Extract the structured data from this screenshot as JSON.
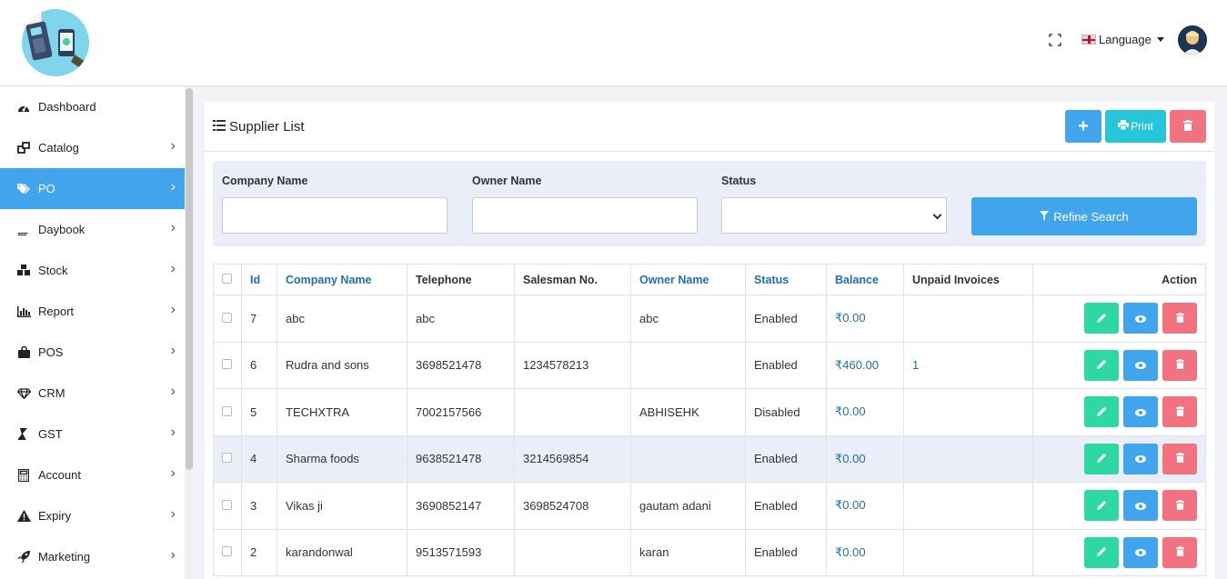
{
  "header": {
    "language_label": "Language"
  },
  "sidebar": {
    "items": [
      {
        "label": "Dashboard",
        "icon": "dashboard-icon",
        "active": false,
        "has_children": false
      },
      {
        "label": "Catalog",
        "icon": "catalog-icon",
        "active": false,
        "has_children": true
      },
      {
        "label": "PO",
        "icon": "tags-icon",
        "active": true,
        "has_children": true
      },
      {
        "label": "Daybook",
        "icon": "book-icon",
        "active": false,
        "has_children": true
      },
      {
        "label": "Stock",
        "icon": "cubes-icon",
        "active": false,
        "has_children": true
      },
      {
        "label": "Report",
        "icon": "bar-chart-icon",
        "active": false,
        "has_children": true
      },
      {
        "label": "POS",
        "icon": "shopping-bag-icon",
        "active": false,
        "has_children": true
      },
      {
        "label": "CRM",
        "icon": "diamond-icon",
        "active": false,
        "has_children": true
      },
      {
        "label": "GST",
        "icon": "gst-icon",
        "active": false,
        "has_children": true
      },
      {
        "label": "Account",
        "icon": "calculator-icon",
        "active": false,
        "has_children": true
      },
      {
        "label": "Expiry",
        "icon": "warning-icon",
        "active": false,
        "has_children": true
      },
      {
        "label": "Marketing",
        "icon": "rocket-icon",
        "active": false,
        "has_children": true
      }
    ]
  },
  "card": {
    "title": "Supplier List",
    "print_label": "Print"
  },
  "filter": {
    "company_label": "Company Name",
    "company_value": "",
    "owner_label": "Owner Name",
    "owner_value": "",
    "status_label": "Status",
    "status_value": "",
    "refine_label": "Refine Search"
  },
  "table": {
    "headers": [
      "Id",
      "Company Name",
      "Telephone",
      "Salesman No.",
      "Owner Name",
      "Status",
      "Balance",
      "Unpaid Invoices",
      "Action"
    ],
    "rows": [
      {
        "id": "7",
        "company": "abc",
        "telephone": "abc",
        "salesman": "",
        "owner": "abc",
        "status": "Enabled",
        "balance": "₹0.00",
        "unpaid": "",
        "highlighted": false
      },
      {
        "id": "6",
        "company": "Rudra and sons",
        "telephone": "3698521478",
        "salesman": "1234578213",
        "owner": "",
        "status": "Enabled",
        "balance": "₹460.00",
        "unpaid": "1",
        "highlighted": false
      },
      {
        "id": "5",
        "company": "TECHXTRA",
        "telephone": "7002157566",
        "salesman": "",
        "owner": "ABHISEHK",
        "status": "Disabled",
        "balance": "₹0.00",
        "unpaid": "",
        "highlighted": false
      },
      {
        "id": "4",
        "company": "Sharma foods",
        "telephone": "9638521478",
        "salesman": "3214569854",
        "owner": "",
        "status": "Enabled",
        "balance": "₹0.00",
        "unpaid": "",
        "highlighted": true
      },
      {
        "id": "3",
        "company": "Vikas ji",
        "telephone": "3690852147",
        "salesman": "3698524708",
        "owner": "gautam adani",
        "status": "Enabled",
        "balance": "₹0.00",
        "unpaid": "",
        "highlighted": false
      },
      {
        "id": "2",
        "company": "karandonwal",
        "telephone": "9513571593",
        "salesman": "",
        "owner": "karan",
        "status": "Enabled",
        "balance": "₹0.00",
        "unpaid": "",
        "highlighted": false
      }
    ]
  },
  "colors": {
    "primary": "#41a5ee",
    "success": "#2ed8a3",
    "info": "#26c6da",
    "danger": "#f2737f",
    "link": "#1f6fb5"
  }
}
